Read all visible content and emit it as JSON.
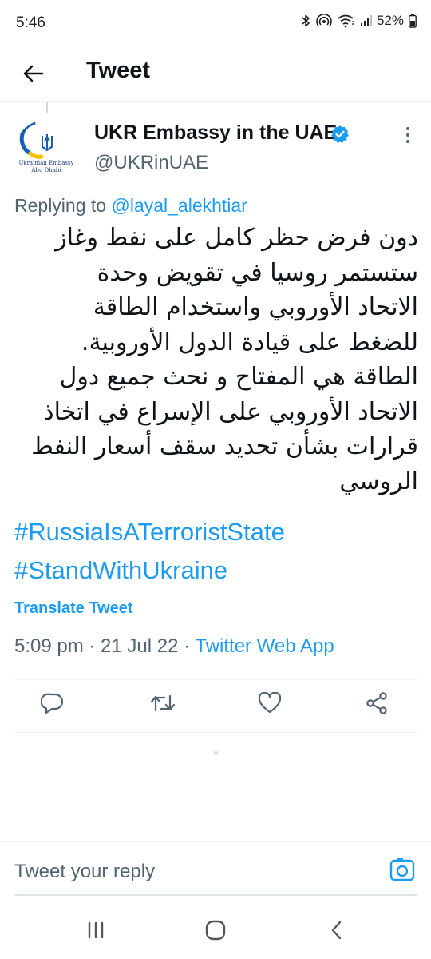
{
  "status_bar": {
    "time": "5:46",
    "battery": "52%",
    "icons": [
      "bluetooth-icon",
      "hotspot-icon",
      "wifi-icon",
      "signal-icon",
      "battery-icon"
    ]
  },
  "header": {
    "title": "Tweet",
    "back_icon": "arrow-left-icon"
  },
  "tweet": {
    "author": {
      "name": "UKR Embassy in the UAE",
      "handle": "@UKRinUAE",
      "verified": true,
      "avatar_caption_line1": "Ukrainian Embassy",
      "avatar_caption_line2": "Abu Dhabi"
    },
    "replying_prefix": "Replying to ",
    "replying_to": "@layal_alekhtiar",
    "body": "دون فرض حظر كامل على نفط وغاز\nستستمر روسيا في تقويض وحدة\nالاتحاد الأوروبي واستخدام الطاقة\nللضغط على قيادة الدول الأوروبية.\nالطاقة هي المفتاح و نحث جميع دول\nالاتحاد الأوروبي على الإسراع في اتخاذ\nقرارات بشأن تحديد سقف أسعار النفط\nالروسي",
    "hashtags": [
      "#RussiaIsATerroristState",
      "#StandWithUkraine"
    ],
    "translate_label": "Translate Tweet",
    "time": "5:09 pm",
    "date": "21 Jul 22",
    "source": "Twitter Web App"
  },
  "actions": [
    {
      "name": "reply",
      "icon": "reply-icon"
    },
    {
      "name": "retweet",
      "icon": "retweet-icon"
    },
    {
      "name": "like",
      "icon": "heart-icon"
    },
    {
      "name": "share",
      "icon": "share-icon"
    }
  ],
  "reply_box": {
    "placeholder": "Tweet your reply"
  },
  "colors": {
    "accent": "#1d9bf0",
    "text": "#0f1419",
    "secondary": "#536471",
    "divider": "#eff3f4",
    "flag_blue": "#1a5fb4",
    "flag_yellow": "#f5c400"
  }
}
